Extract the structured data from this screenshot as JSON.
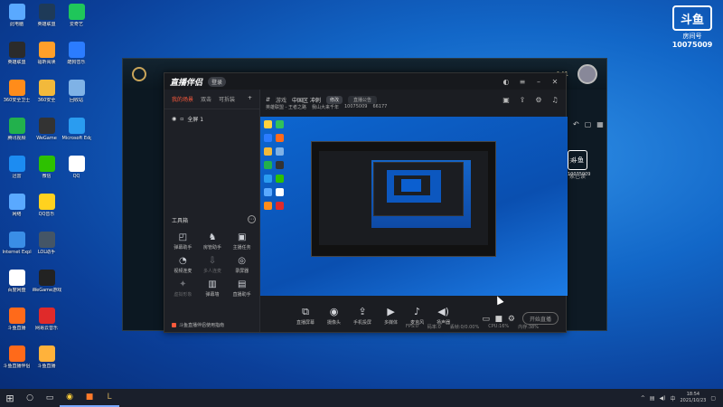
{
  "desktop": {
    "icons": [
      {
        "label": "此电脑",
        "color": "#5aa9ff"
      },
      {
        "label": "英雄联盟",
        "color": "#1e3a58"
      },
      {
        "label": "爱奇艺",
        "color": "#1fc65a"
      },
      {
        "label": "英雄联盟",
        "color": "#2b2b2b"
      },
      {
        "label": "福昕阅读",
        "color": "#ff9f2a"
      },
      {
        "label": "酷狗音乐",
        "color": "#2b7cff"
      },
      {
        "label": "360安全卫士",
        "color": "#ff8c1a"
      },
      {
        "label": "360安全",
        "color": "#f2b93b"
      },
      {
        "label": "回收站",
        "color": "#7fb2e6"
      },
      {
        "label": "腾讯视频",
        "color": "#22b14c"
      },
      {
        "label": "WeGame",
        "color": "#333333"
      },
      {
        "label": "Microsoft Edge",
        "color": "#2a9cf0"
      },
      {
        "label": "迅雷",
        "color": "#1c8cf2"
      },
      {
        "label": "微信",
        "color": "#2dc100"
      },
      {
        "label": "QQ",
        "color": "#ffffff"
      },
      {
        "label": "网络",
        "color": "#5aa9ff"
      },
      {
        "label": "QQ音乐",
        "color": "#ffd21f"
      },
      {
        "label": "",
        "color": "transparent"
      },
      {
        "label": "Internet Explorer",
        "color": "#3a8ee6"
      },
      {
        "label": "LOL助手",
        "color": "#445566"
      },
      {
        "label": "",
        "color": "transparent"
      },
      {
        "label": "百度网盘",
        "color": "#ffffff"
      },
      {
        "label": "WeGame游戏",
        "color": "#222222"
      },
      {
        "label": "",
        "color": "transparent"
      },
      {
        "label": "斗鱼直播",
        "color": "#ff6a1a"
      },
      {
        "label": "网易云音乐",
        "color": "#e02a2a"
      },
      {
        "label": "",
        "color": "transparent"
      },
      {
        "label": "斗鱼直播伴侣",
        "color": "#ff6a1a"
      },
      {
        "label": "斗鱼直播",
        "color": "#ffb23b"
      },
      {
        "label": "",
        "color": "transparent"
      }
    ]
  },
  "brand_logo": {
    "mark": "斗鱼",
    "room_label": "房间号",
    "room_number": "10075009"
  },
  "game_window": {
    "level": "141",
    "side_text_1": "天",
    "side_text_2": "家已读"
  },
  "stream_app": {
    "brand": "直播伴侣",
    "badge": "登录",
    "left_tabs": [
      "我的场景",
      "双击",
      "可拆装"
    ],
    "scene_label": "全屏 1",
    "tools_title": "工具箱",
    "tools": [
      {
        "icon": "◰",
        "label": "弹幕助手",
        "dim": false
      },
      {
        "icon": "♞",
        "label": "房管助手",
        "dim": false
      },
      {
        "icon": "▣",
        "label": "主播任务",
        "dim": false
      },
      {
        "icon": "◔",
        "label": "视频连麦",
        "dim": false
      },
      {
        "icon": "⇩",
        "label": "多人连麦",
        "dim": true
      },
      {
        "icon": "◎",
        "label": "录屏器",
        "dim": false
      },
      {
        "icon": "✦",
        "label": "虚拟形象",
        "dim": true
      },
      {
        "icon": "▥",
        "label": "弹幕墙",
        "dim": false
      },
      {
        "icon": "▤",
        "label": "直播助手",
        "dim": false
      }
    ],
    "notice": "斗鱼直播伴侣使用指南",
    "info": {
      "category": "游戏",
      "name": "英雄联盟",
      "sub": "中国区 冲刺",
      "edit": "修改",
      "notice_btn": "直播公告",
      "line2_a": "英雄联盟 - 王者之路",
      "line2_b": "我山大来千年",
      "line2_c": "10075009",
      "line2_d": "66177"
    },
    "controls": [
      {
        "icon": "⧉",
        "label": "直播屏幕"
      },
      {
        "icon": "◉",
        "label": "摄像头"
      },
      {
        "icon": "⇪",
        "label": "手机投屏"
      },
      {
        "icon": "▶",
        "label": "多媒体"
      },
      {
        "icon": "♪",
        "label": "麦克风"
      },
      {
        "icon": "◀)",
        "label": "扬声器"
      }
    ],
    "live_button": "开始直播",
    "status": [
      "FPS:0",
      "码率:0",
      "丢帧:0/0.00%",
      "CPU:16%",
      "内存:38%"
    ]
  },
  "taskbar": {
    "time": "18:54",
    "date": "2021/10/23"
  }
}
